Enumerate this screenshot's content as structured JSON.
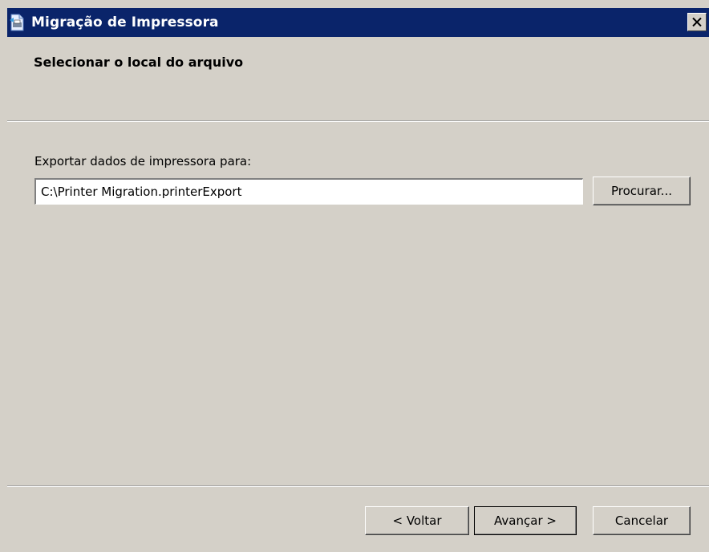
{
  "window": {
    "title": "Migração de Impressora"
  },
  "page": {
    "title": "Selecionar o local do arquivo"
  },
  "export": {
    "label": "Exportar dados de impressora para:",
    "path_value": "C:\\Printer Migration.printerExport",
    "browse_label": "Procurar..."
  },
  "footer": {
    "back_label": "< Voltar",
    "next_label": "Avançar >",
    "cancel_label": "Cancelar"
  },
  "icons": {
    "app": "printer-migration-icon",
    "close": "close-icon"
  },
  "colors": {
    "titlebar": "#0a246a",
    "face": "#d4d0c8"
  }
}
